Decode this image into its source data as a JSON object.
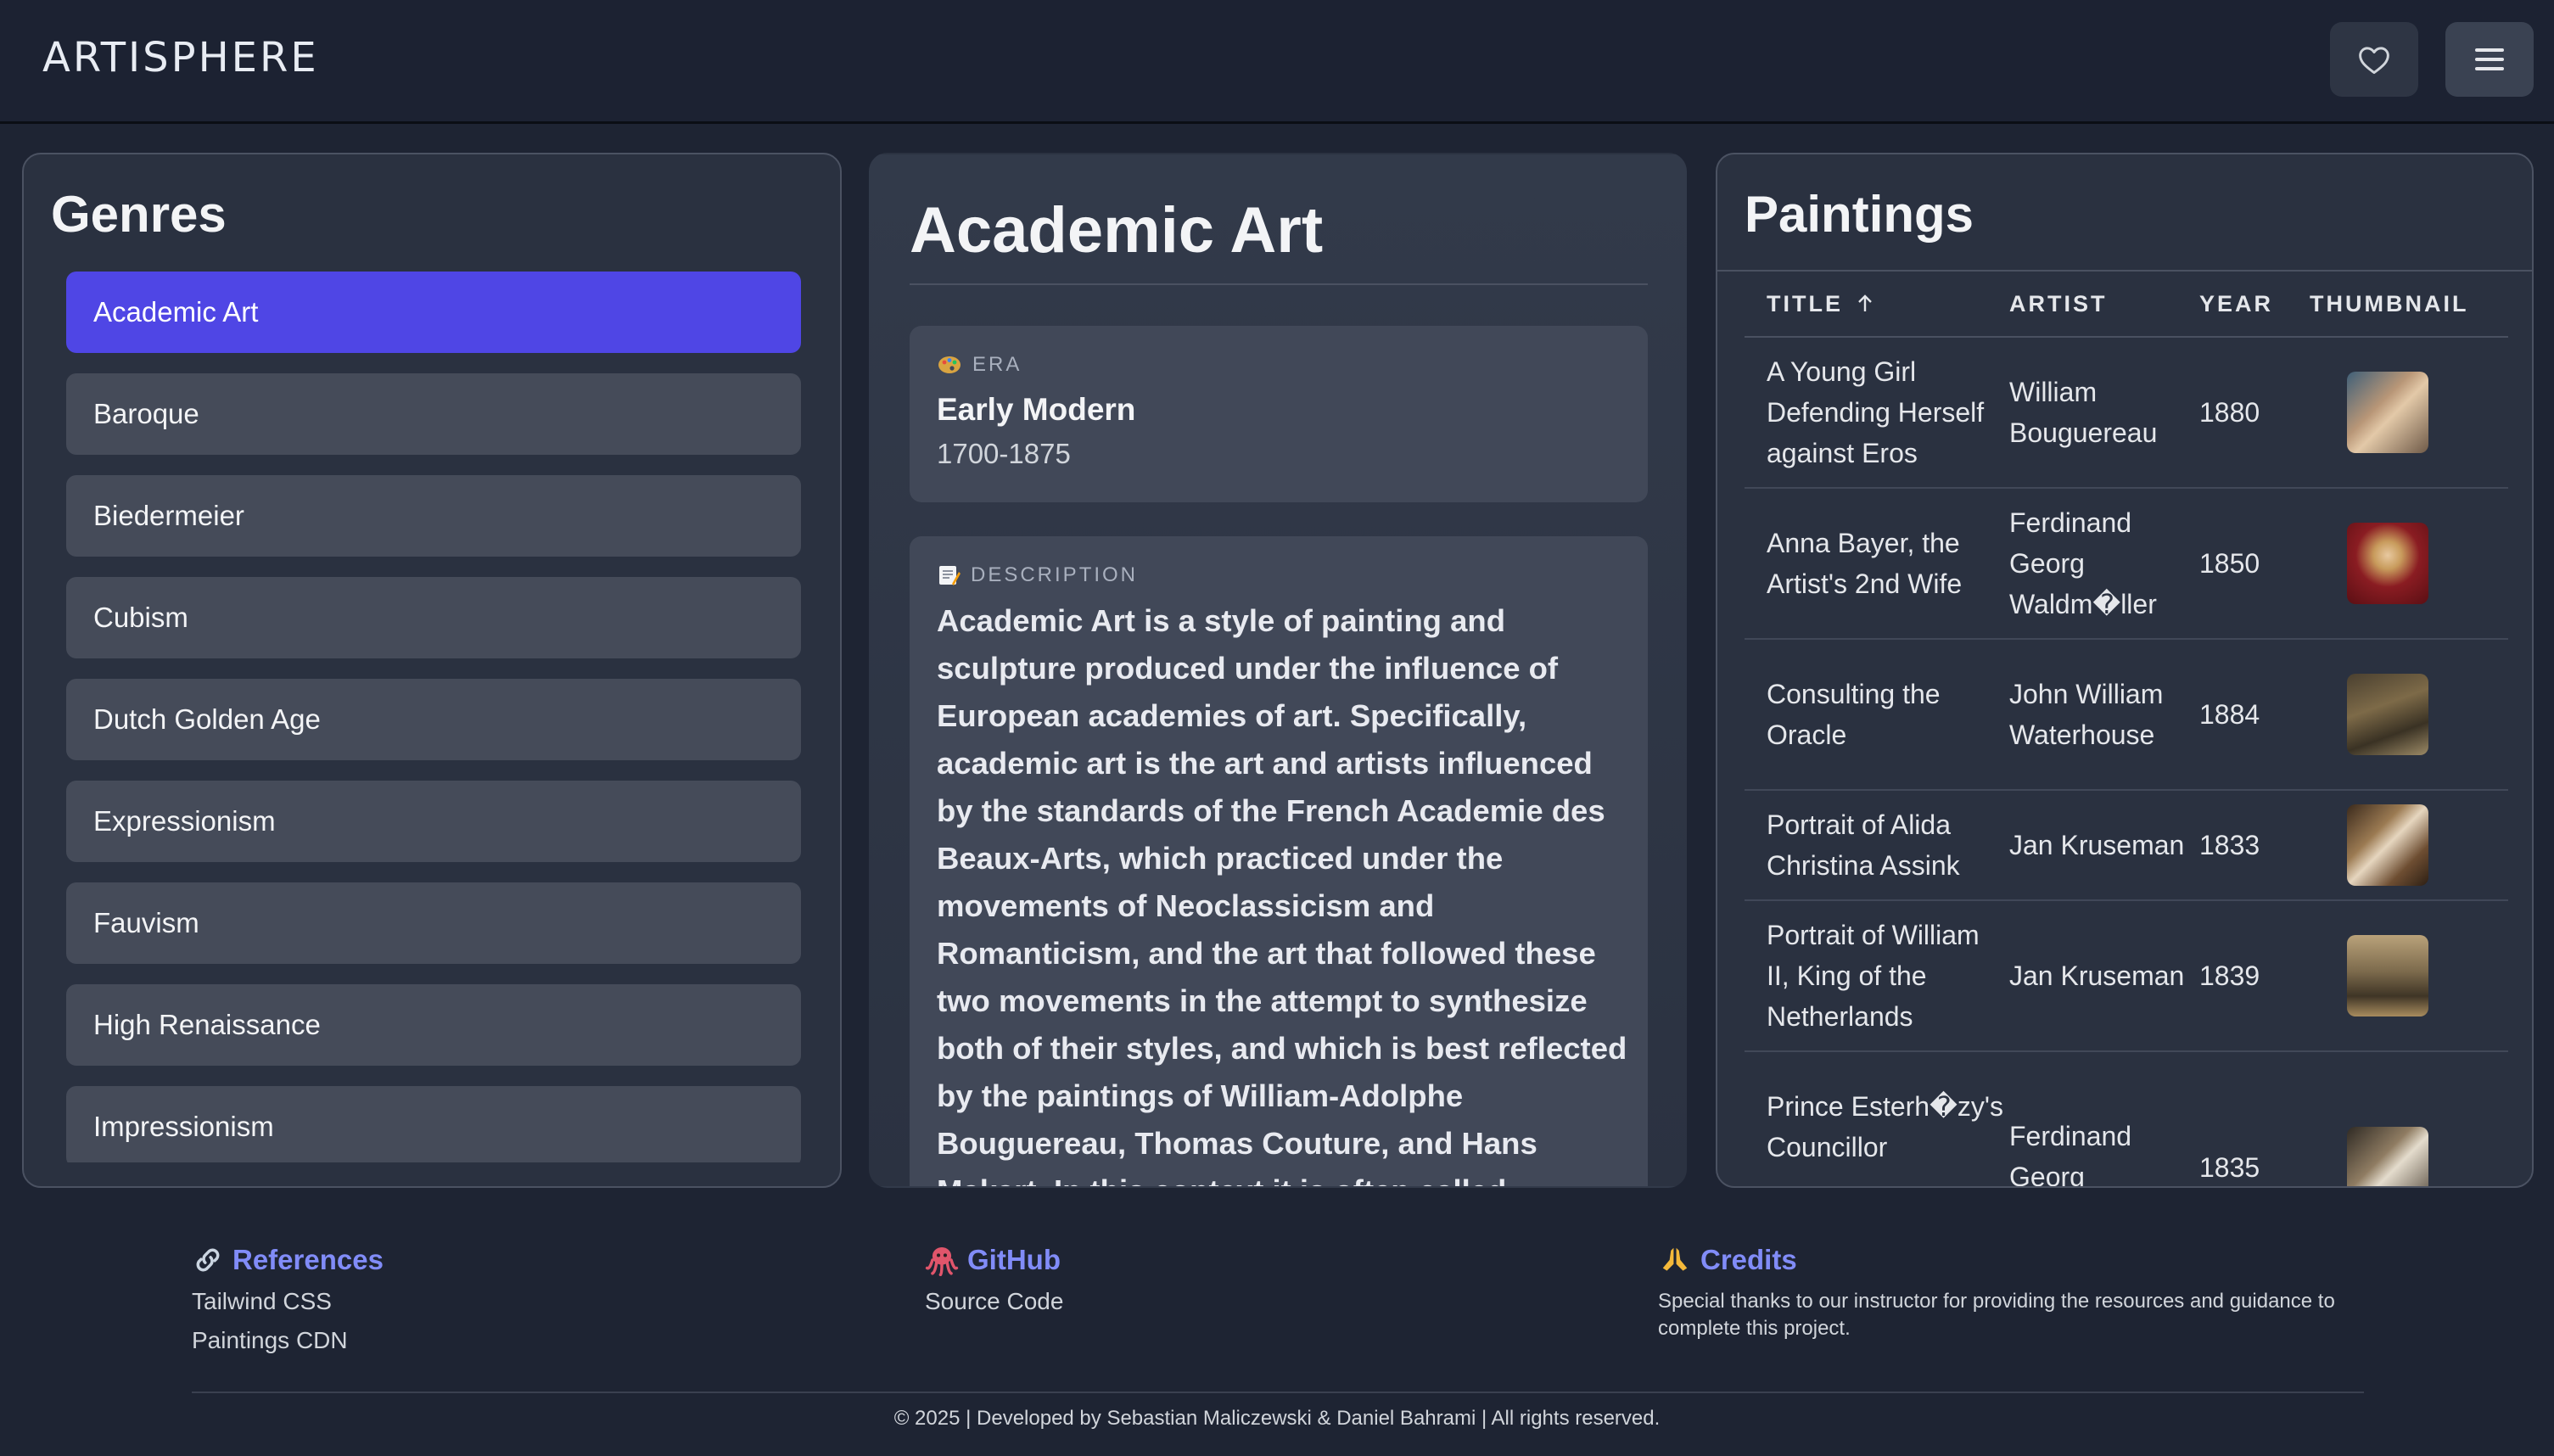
{
  "header": {
    "brand": "ARTISPHERE",
    "favorites_icon": "heart-outline-icon",
    "menu_icon": "hamburger-menu-icon"
  },
  "genres": {
    "title": "Genres",
    "items": [
      {
        "label": "Academic Art",
        "active": true
      },
      {
        "label": "Baroque"
      },
      {
        "label": "Biedermeier"
      },
      {
        "label": "Cubism"
      },
      {
        "label": "Dutch Golden Age"
      },
      {
        "label": "Expressionism"
      },
      {
        "label": "Fauvism"
      },
      {
        "label": "High Renaissance"
      },
      {
        "label": "Impressionism"
      }
    ]
  },
  "detail": {
    "title": "Academic Art",
    "era_label": "ERA",
    "era_icon": "palette-emoji",
    "era_name": "Early Modern",
    "era_years": "1700-1875",
    "description_label": "DESCRIPTION",
    "description_icon": "memo-emoji",
    "description": "Academic Art is a style of painting and sculpture produced under the influence of European academies of art. Specifically, academic art is the art and artists influenced by the standards of the French Academie des Beaux-Arts, which practiced under the movements of Neoclassicism and Romanticism, and the art that followed these two movements in the attempt to synthesize both of their styles, and which is best reflected by the paintings of William-Adolphe Bouguereau, Thomas Couture, and Hans Makart. In this context it is often called \"academism\", \"academicism\", \"l'art"
  },
  "paintings": {
    "title": "Paintings",
    "columns": {
      "title": "TITLE",
      "sort_icon": "arrow-up-icon",
      "artist": "ARTIST",
      "year": "YEAR",
      "thumbnail": "THUMBNAIL"
    },
    "rows": [
      {
        "title": "A Young Girl Defending Herself against Eros",
        "artist": "William Bouguereau",
        "year": "1880"
      },
      {
        "title": "Anna Bayer, the Artist's 2nd Wife",
        "artist": "Ferdinand Georg Waldm�ller",
        "year": "1850"
      },
      {
        "title": "Consulting the Oracle",
        "artist": "John William Waterhouse",
        "year": "1884"
      },
      {
        "title": "Portrait of Alida Christina Assink",
        "artist": "Jan Kruseman",
        "year": "1833"
      },
      {
        "title": "Portrait of William II, King of the Netherlands",
        "artist": "Jan Kruseman",
        "year": "1839"
      },
      {
        "title": "Prince Esterh�zy's Councillor",
        "artist": "Ferdinand Georg",
        "year": "1835"
      }
    ]
  },
  "footer": {
    "references": {
      "icon": "link-emoji",
      "title": "References",
      "links": [
        "Tailwind CSS",
        "Paintings CDN"
      ]
    },
    "github": {
      "icon": "octopus-emoji",
      "title": "GitHub",
      "links": [
        "Source Code"
      ]
    },
    "credits": {
      "icon": "folded-hands-emoji",
      "title": "Credits",
      "note": "Special thanks to our instructor for providing the resources and guidance to complete this project."
    },
    "copyright": "© 2025 | Developed by Sebastian Maliczewski & Daniel Bahrami | All rights reserved."
  }
}
